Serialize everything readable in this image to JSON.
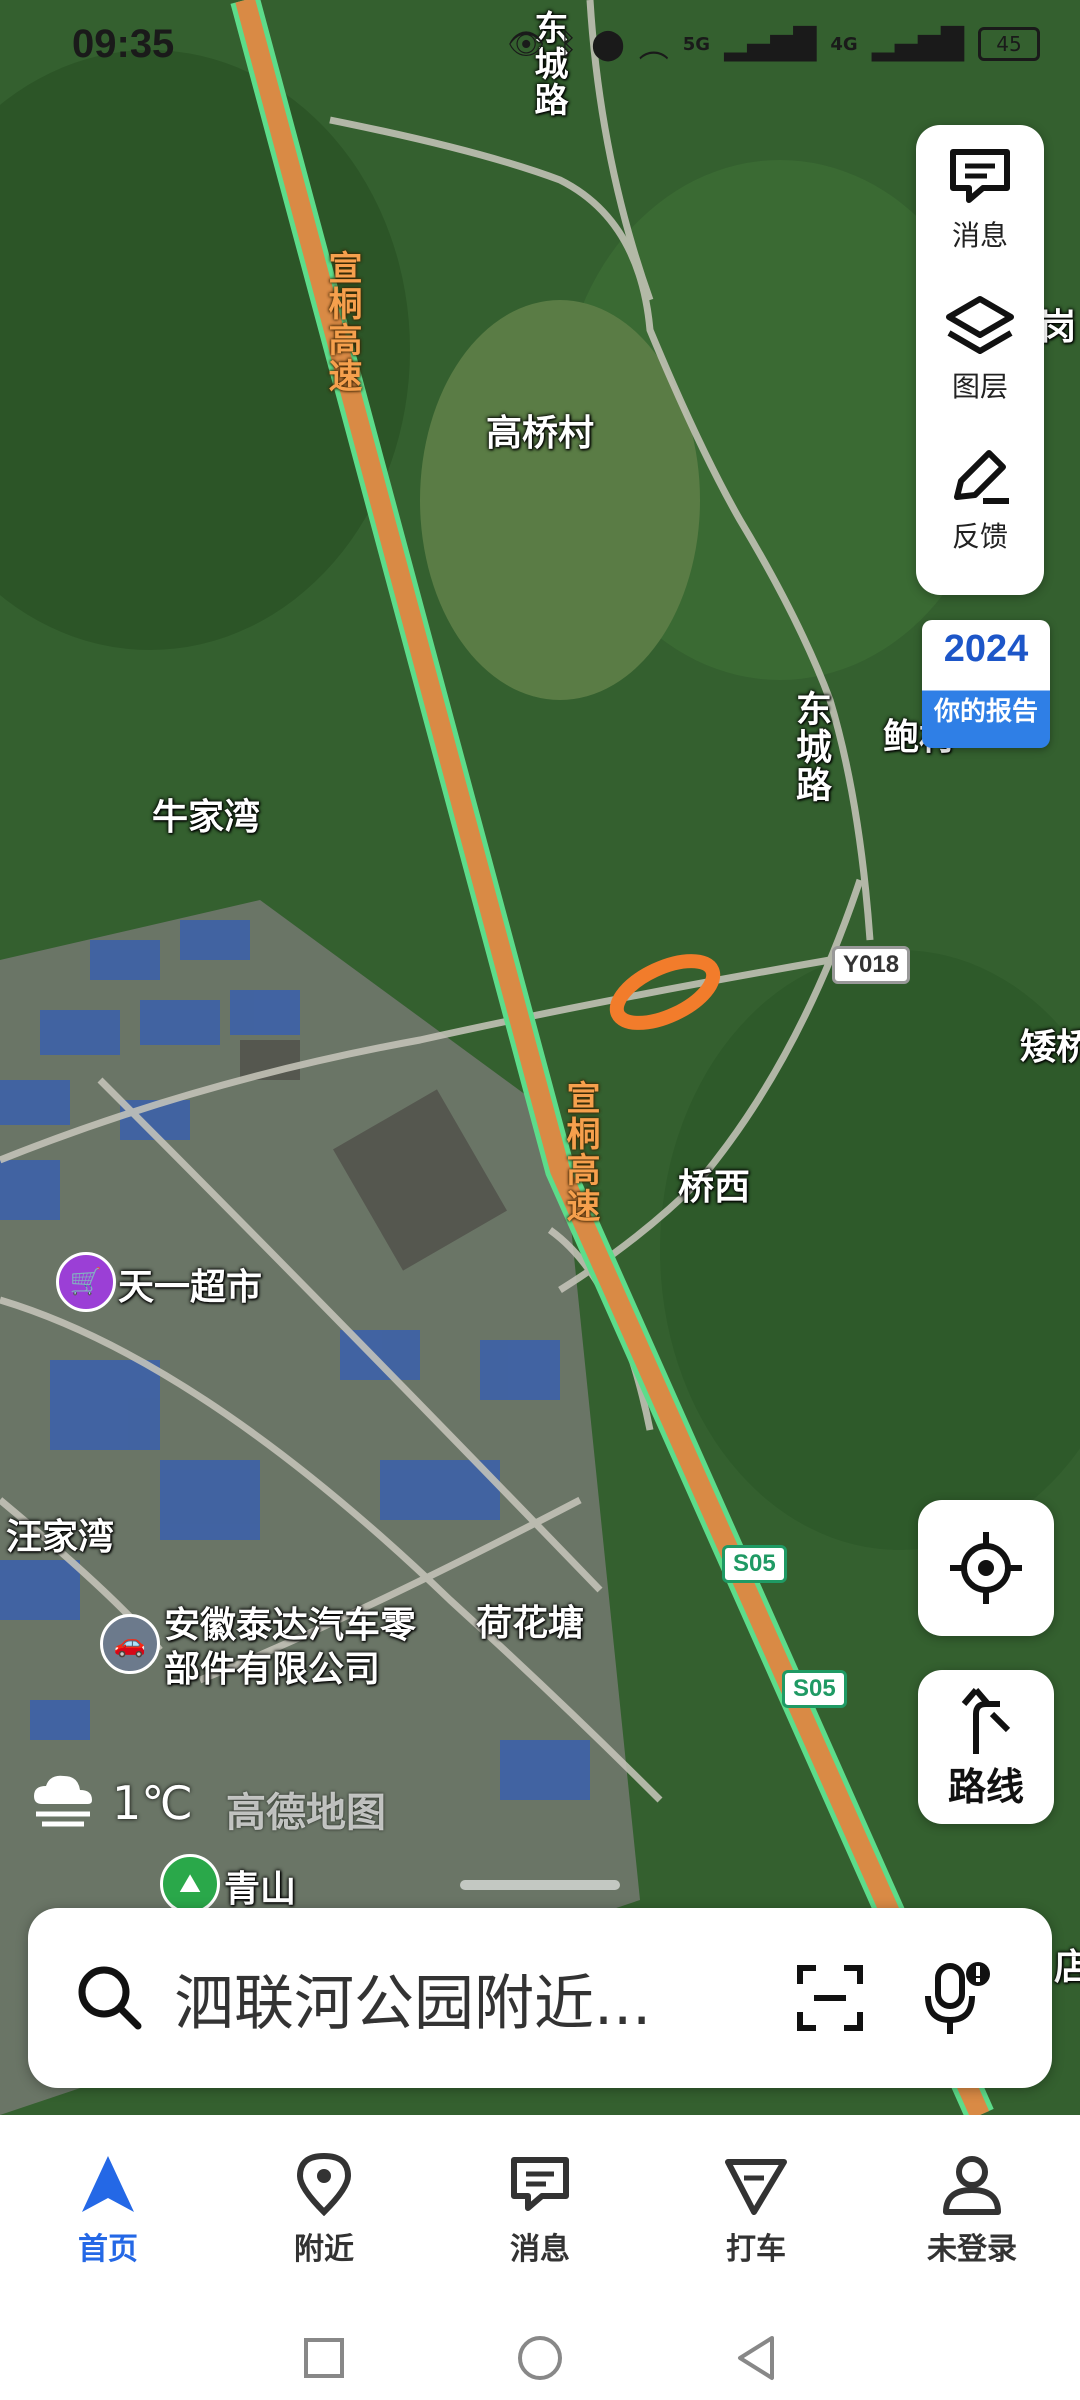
{
  "status": {
    "time": "09:35",
    "signal_5g": "5G",
    "signal_4g": "4G",
    "battery": "45"
  },
  "map": {
    "roads": {
      "highway_label_top": "宣桐高速",
      "highway_label_mid": "宣桐高速",
      "dongcheng_top": "东城路",
      "dongcheng_mid": "东城路",
      "shield_y018": "Y018",
      "shield_s05_a": "S05",
      "shield_s05_b": "S05"
    },
    "places": {
      "gaoqiao": "高桥村",
      "niujiawan": "牛家湾",
      "qiaoxi": "桥西",
      "wangjiawan": "汪家湾",
      "hehuatang": "荷花塘",
      "qingshan": "青山",
      "bao": "鲍村",
      "ai": "矮桥",
      "gang": "岗",
      "dian": "店"
    },
    "pois": {
      "supermarket": "天一超市",
      "company_line1": "安徽泰达汽车零",
      "company_line2": "部件有限公司"
    },
    "watermark": "高德地图"
  },
  "panel": {
    "messages": "消息",
    "layers": "图层",
    "feedback": "反馈"
  },
  "report": {
    "year": "2024",
    "label": "你的报告"
  },
  "route_button": {
    "label": "路线"
  },
  "weather": {
    "temp": "1℃"
  },
  "search": {
    "query": "泗联河公园附近..."
  },
  "tabs": [
    {
      "label": "首页"
    },
    {
      "label": "附近"
    },
    {
      "label": "消息"
    },
    {
      "label": "打车"
    },
    {
      "label": "未登录"
    }
  ],
  "colors": {
    "accent": "#2468e6",
    "highway": "#d98a45",
    "highway_edge": "#5ddc8a"
  }
}
